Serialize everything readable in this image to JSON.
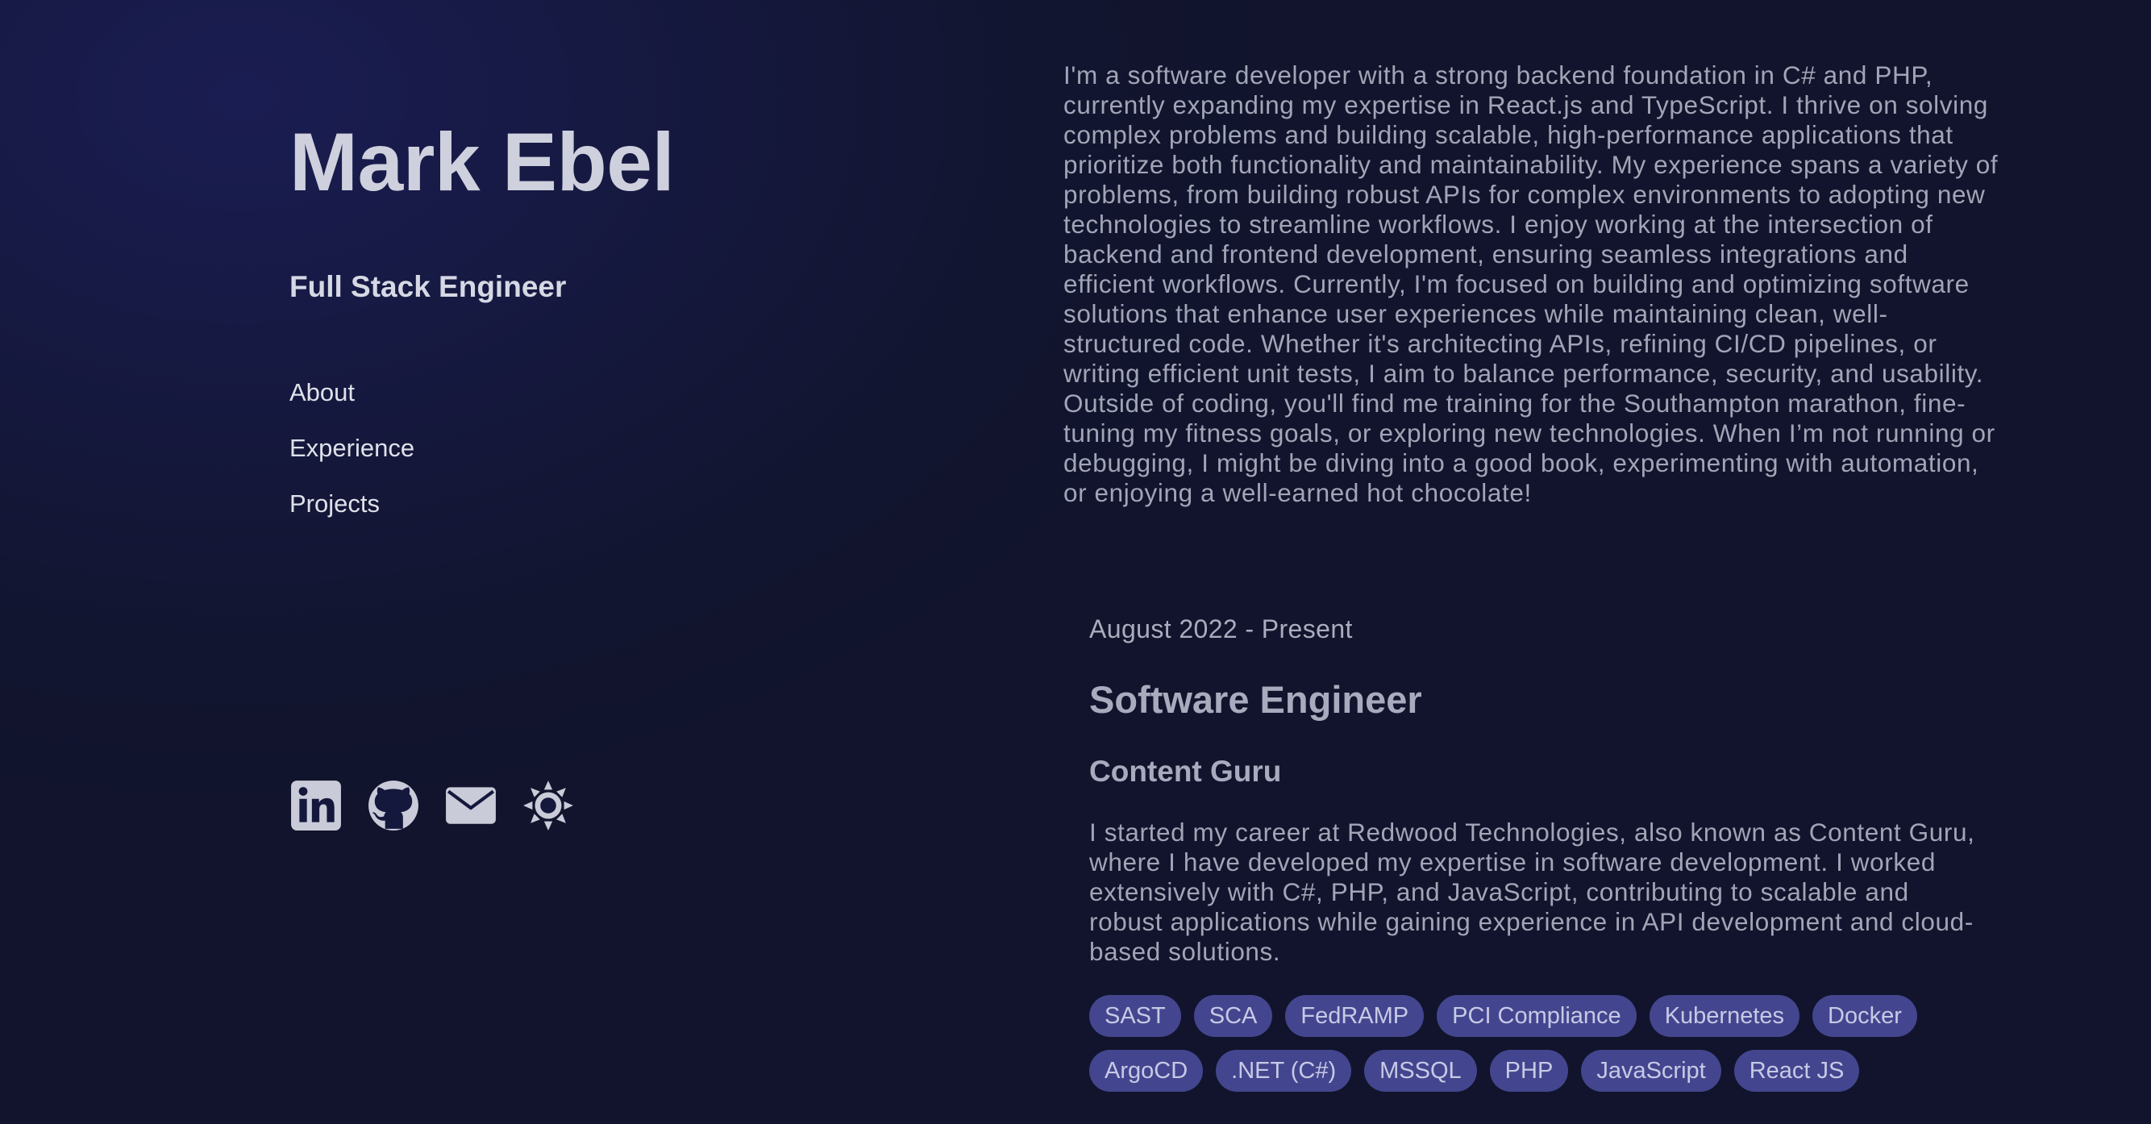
{
  "profile": {
    "name": "Mark Ebel",
    "role": "Full Stack Engineer"
  },
  "nav": {
    "items": [
      {
        "label": "About"
      },
      {
        "label": "Experience"
      },
      {
        "label": "Projects"
      }
    ]
  },
  "socials": [
    {
      "icon": "linkedin-icon"
    },
    {
      "icon": "github-icon"
    },
    {
      "icon": "mail-icon"
    },
    {
      "icon": "theme-toggle-sun-icon"
    }
  ],
  "about": {
    "text": "I'm a software developer with a strong backend foundation in C# and PHP, currently expanding my expertise in React.js and TypeScript. I thrive on solving complex problems and building scalable, high-performance applications that prioritize both functionality and maintainability. My experience spans a variety of problems, from building robust APIs for complex environments to adopting new technologies to streamline workflows. I enjoy working at the intersection of backend and frontend development, ensuring seamless integrations and efficient workflows. Currently, I'm focused on building and optimizing software solutions that enhance user experiences while maintaining clean, well-structured code. Whether it's architecting APIs, refining CI/CD pipelines, or writing efficient unit tests, I aim to balance performance, security, and usability. Outside of coding, you'll find me training for the Southampton marathon, fine-tuning my fitness goals, or exploring new technologies. When I’m not running or debugging, I might be diving into a good book, experimenting with automation, or enjoying a well-earned hot chocolate!"
  },
  "experience": [
    {
      "date": "August 2022 - Present",
      "title": "Software Engineer",
      "company": "Content Guru",
      "description": "I started my career at Redwood Technologies, also known as Content Guru, where I have developed my expertise in software development. I worked extensively with C#, PHP, and JavaScript, contributing to scalable and robust applications while gaining experience in API development and cloud-based solutions.",
      "tags": [
        "SAST",
        "SCA",
        "FedRAMP",
        "PCI Compliance",
        "Kubernetes",
        "Docker",
        "ArgoCD",
        ".NET (C#)",
        "MSSQL",
        "PHP",
        "JavaScript",
        "React JS"
      ]
    }
  ],
  "colors": {
    "background": "#13163a",
    "heading": "#ced0dd",
    "body_text": "#a1a5b6",
    "tag_bg": "#43468e",
    "tag_text": "#c7c9e6"
  }
}
